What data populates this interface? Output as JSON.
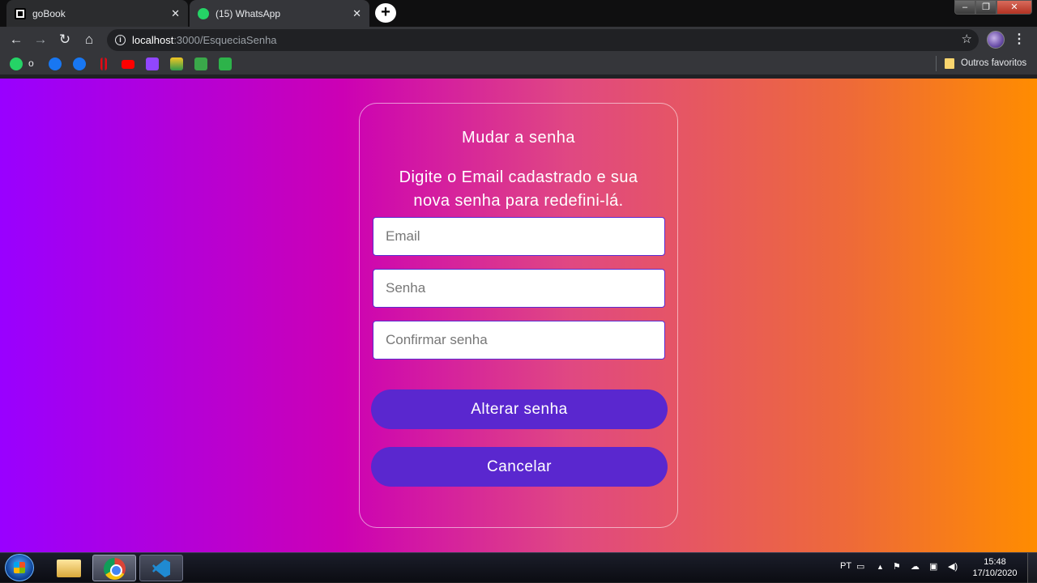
{
  "browser": {
    "tabs": [
      {
        "title": "goBook"
      },
      {
        "title": "(15) WhatsApp"
      }
    ],
    "new_tab": "+",
    "tab_close": "✕",
    "url_host": "localhost",
    "url_path": ":3000/EsqueciaSenha",
    "bookmarks": {
      "whatsapp_label": "o",
      "others": "Outros favoritos"
    }
  },
  "form": {
    "title": "Mudar a senha",
    "description": "Digite o Email cadastrado e sua nova senha para redefini-lá.",
    "email_placeholder": "Email",
    "password_placeholder": "Senha",
    "confirm_placeholder": "Confirmar senha",
    "submit_label": "Alterar senha",
    "cancel_label": "Cancelar"
  },
  "taskbar": {
    "language": "PT",
    "time": "15:48",
    "date": "17/10/2020"
  },
  "colors": {
    "gradient_start": "#9900ff",
    "gradient_end": "#ff8c00",
    "button": "#5a27cf"
  }
}
